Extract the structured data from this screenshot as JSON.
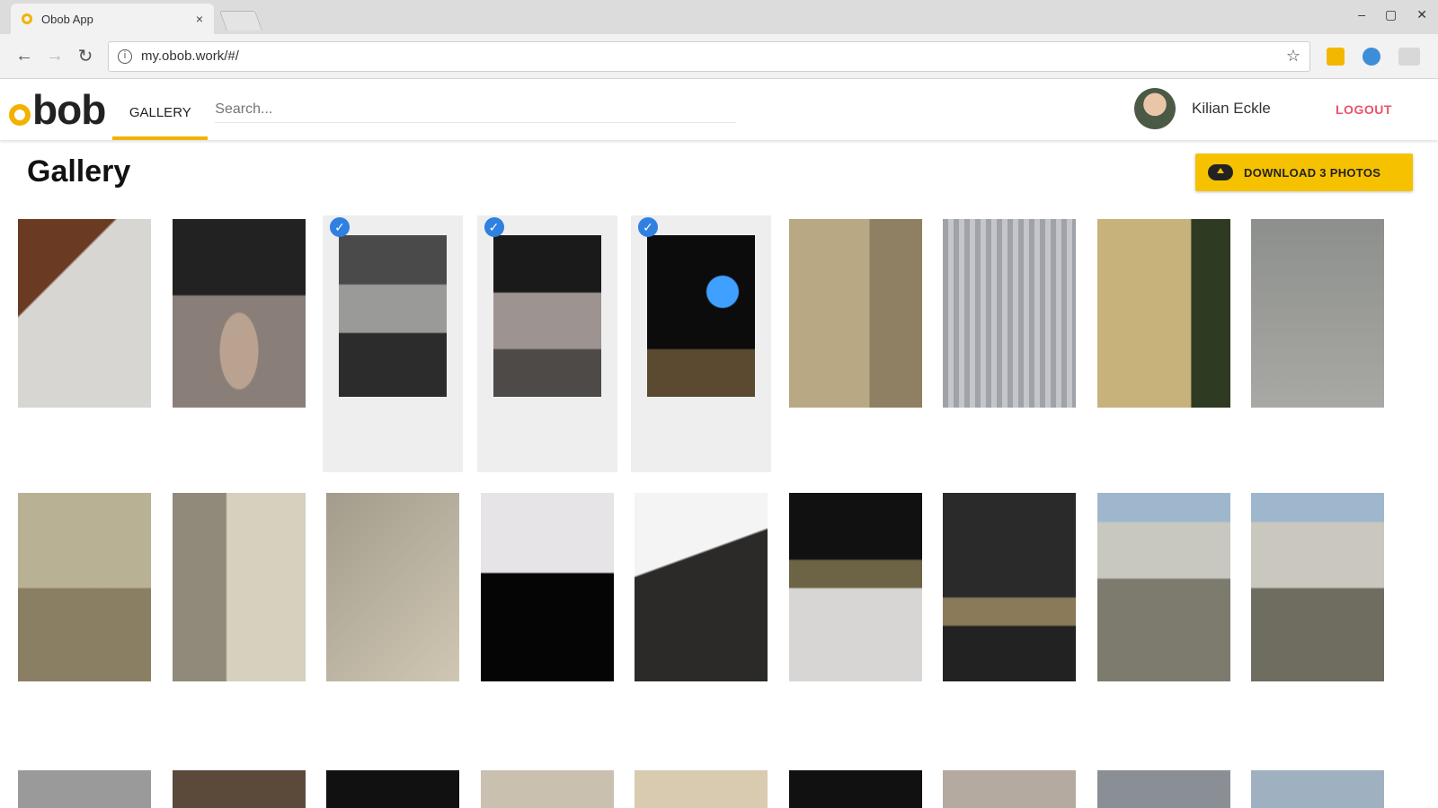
{
  "browser": {
    "tab_title": "Obob App",
    "tab_close": "×",
    "url": "my.obob.work/#/",
    "win_controls": [
      "–",
      "▢",
      "✕"
    ]
  },
  "header": {
    "nav_gallery": "GALLERY",
    "search_placeholder": "Search...",
    "user_name": "Kilian Eckle",
    "logout": "LOGOUT",
    "accent_color": "#f2b200"
  },
  "page": {
    "title": "Gallery",
    "download_button": "DOWNLOAD 3 PHOTOS"
  },
  "photos": [
    {
      "selected": false,
      "style": "bg-table"
    },
    {
      "selected": false,
      "style": "bg-hall"
    },
    {
      "selected": true,
      "style": "bg-hall2"
    },
    {
      "selected": true,
      "style": "bg-hall3"
    },
    {
      "selected": true,
      "style": "bg-night"
    },
    {
      "selected": false,
      "style": "bg-facade"
    },
    {
      "selected": false,
      "style": "bg-fence"
    },
    {
      "selected": false,
      "style": "bg-tower"
    },
    {
      "selected": false,
      "style": "bg-wall"
    },
    {
      "selected": false,
      "style": "bg-concrete"
    },
    {
      "selected": false,
      "style": "bg-alley"
    },
    {
      "selected": false,
      "style": "bg-rubble"
    },
    {
      "selected": false,
      "style": "bg-doc"
    },
    {
      "selected": false,
      "style": "bg-laptop"
    },
    {
      "selected": false,
      "style": "bg-dark"
    },
    {
      "selected": false,
      "style": "bg-dark2"
    },
    {
      "selected": false,
      "style": "bg-city"
    },
    {
      "selected": false,
      "style": "bg-city2"
    }
  ]
}
